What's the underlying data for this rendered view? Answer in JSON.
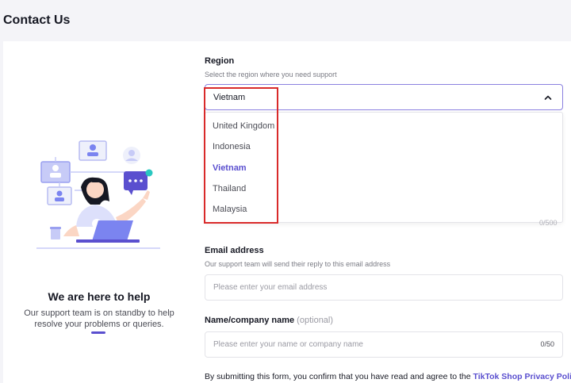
{
  "page": {
    "title": "Contact Us"
  },
  "help": {
    "title": "We are here to help",
    "text": "Our support team is on standby to help resolve your problems or queries."
  },
  "region": {
    "label": "Region",
    "sublabel": "Select the region where you need support",
    "selected": "Vietnam",
    "options": [
      "United Kingdom",
      "Indonesia",
      "Vietnam",
      "Thailand",
      "Malaysia"
    ]
  },
  "hidden_counter": "0/500",
  "email": {
    "label": "Email address",
    "sublabel": "Our support team will send their reply to this email address",
    "placeholder": "Please enter your email address"
  },
  "name": {
    "label": "Name/company name",
    "optional": "(optional)",
    "placeholder": "Please enter your name or company name",
    "counter": "0/50"
  },
  "consent": {
    "text": "By submitting this form, you confirm that you have read and agree to the ",
    "link": "TikTok Shop Privacy Policy"
  },
  "colors": {
    "accent": "#5a4fcf",
    "highlight_box": "#d92a2a",
    "illustration_blue": "#7b84f0"
  }
}
